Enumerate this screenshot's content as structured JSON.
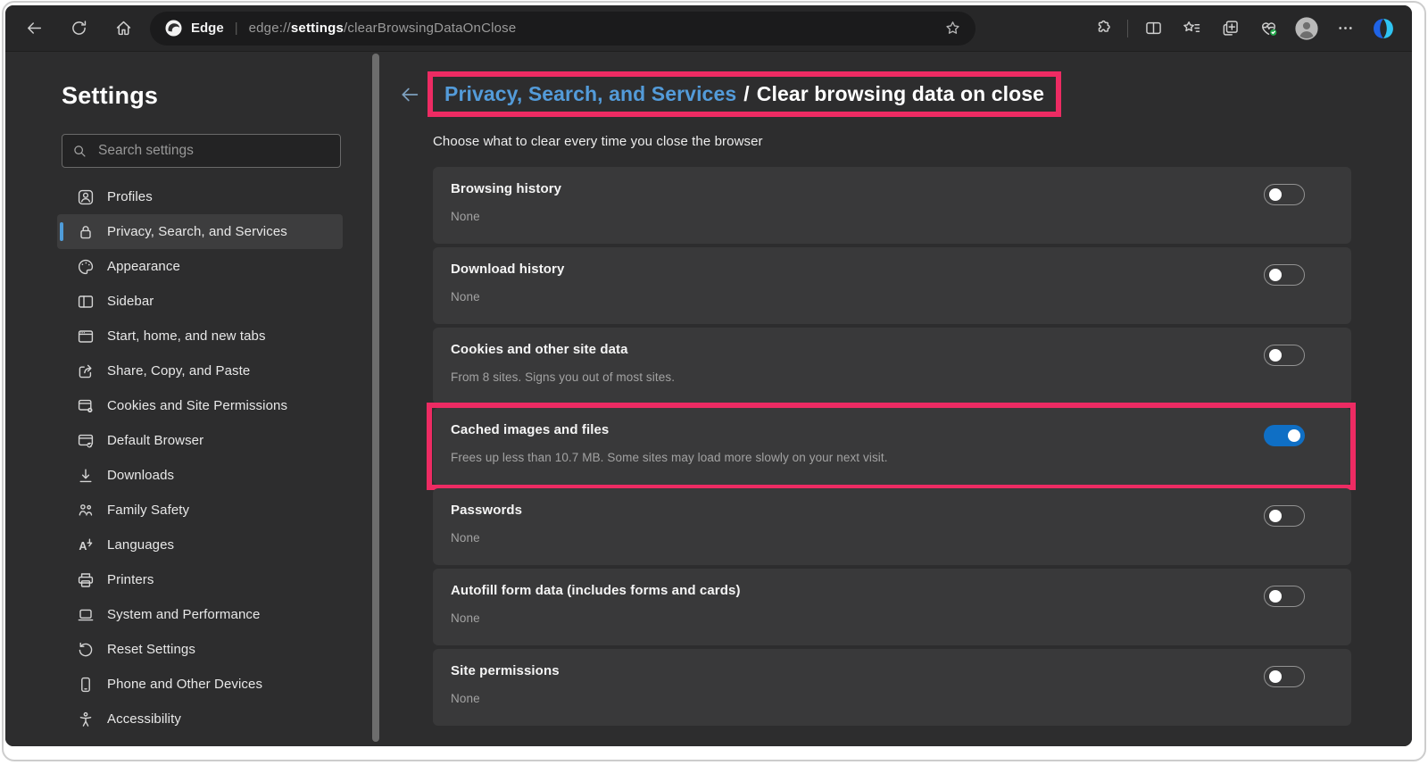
{
  "browser": {
    "brand": "Edge",
    "url": {
      "scheme": "edge://",
      "highlight": "settings",
      "path": "/clearBrowsingDataOnClose"
    },
    "address_divider": "|",
    "nav_buttons": [
      "back",
      "refresh",
      "home"
    ],
    "toolbar_buttons": [
      "extensions",
      "split-screen",
      "favorites",
      "collections",
      "browser-essentials",
      "profile",
      "more",
      "copilot"
    ]
  },
  "sidebar": {
    "title": "Settings",
    "search_placeholder": "Search settings",
    "items": [
      {
        "label": "Profiles",
        "icon": "profiles",
        "selected": false
      },
      {
        "label": "Privacy, Search, and Services",
        "icon": "lock",
        "selected": true
      },
      {
        "label": "Appearance",
        "icon": "palette",
        "selected": false
      },
      {
        "label": "Sidebar",
        "icon": "sidebar-layout",
        "selected": false
      },
      {
        "label": "Start, home, and new tabs",
        "icon": "start-tabs",
        "selected": false
      },
      {
        "label": "Share, Copy, and Paste",
        "icon": "share",
        "selected": false
      },
      {
        "label": "Cookies and Site Permissions",
        "icon": "cookies-permissions",
        "selected": false
      },
      {
        "label": "Default Browser",
        "icon": "default-browser",
        "selected": false
      },
      {
        "label": "Downloads",
        "icon": "downloads",
        "selected": false
      },
      {
        "label": "Family Safety",
        "icon": "family",
        "selected": false
      },
      {
        "label": "Languages",
        "icon": "languages",
        "selected": false
      },
      {
        "label": "Printers",
        "icon": "printers",
        "selected": false
      },
      {
        "label": "System and Performance",
        "icon": "system",
        "selected": false
      },
      {
        "label": "Reset Settings",
        "icon": "reset",
        "selected": false
      },
      {
        "label": "Phone and Other Devices",
        "icon": "phone",
        "selected": false
      },
      {
        "label": "Accessibility",
        "icon": "accessibility",
        "selected": false
      }
    ]
  },
  "main": {
    "breadcrumb": {
      "parent": "Privacy, Search, and Services",
      "separator": "/",
      "current": "Clear browsing data on close"
    },
    "subtitle": "Choose what to clear every time you close the browser",
    "rows": [
      {
        "title": "Browsing history",
        "description": "None",
        "toggle": "off",
        "highlighted": false
      },
      {
        "title": "Download history",
        "description": "None",
        "toggle": "off",
        "highlighted": false
      },
      {
        "title": "Cookies and other site data",
        "description": "From 8 sites. Signs you out of most sites.",
        "toggle": "off",
        "highlighted": false
      },
      {
        "title": "Cached images and files",
        "description": "Frees up less than 10.7 MB. Some sites may load more slowly on your next visit.",
        "toggle": "on",
        "highlighted": true
      },
      {
        "title": "Passwords",
        "description": "None",
        "toggle": "off",
        "highlighted": false
      },
      {
        "title": "Autofill form data (includes forms and cards)",
        "description": "None",
        "toggle": "off",
        "highlighted": false
      },
      {
        "title": "Site permissions",
        "description": "None",
        "toggle": "off",
        "highlighted": false
      }
    ]
  },
  "colors": {
    "annotation_pink": "#ED2B63",
    "toggle_on_blue": "#0F6FC5",
    "link_blue": "#539BD9",
    "selected_accent_blue": "#4F9CD9",
    "essentials_badge_green": "#23A84B"
  }
}
